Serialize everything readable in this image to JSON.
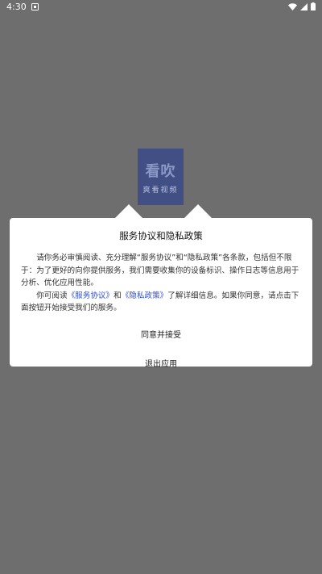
{
  "status_bar": {
    "time": "4:30",
    "icons": [
      "notification-icon",
      "wifi-icon",
      "signal-icon",
      "battery-icon"
    ]
  },
  "splash": {
    "logo_text": "看吹",
    "logo_subtext": "爽看视频"
  },
  "dialog": {
    "title": "服务协议和隐私政策",
    "paragraph1": "请你务必审慎阅读、充分理解“服务协议”和“隐私政策”各条款，包括但不限于：为了更好的向你提供服务，我们需要收集你的设备标识、操作日志等信息用于分析、优化应用性能。",
    "p2_prefix": "你可阅读",
    "service_link": "《服务协议》",
    "p2_and": "和",
    "privacy_link": "《隐私政策》",
    "p2_suffix": "了解详细信息。如果你同意，请点击下面按钮开始接受我们的服务。",
    "agree_button": "同意并接受",
    "exit_button": "退出应用"
  },
  "colors": {
    "backdrop": "#6e6e6e",
    "link": "#2f4fd8",
    "logo_bg": "#3a4a8a"
  }
}
